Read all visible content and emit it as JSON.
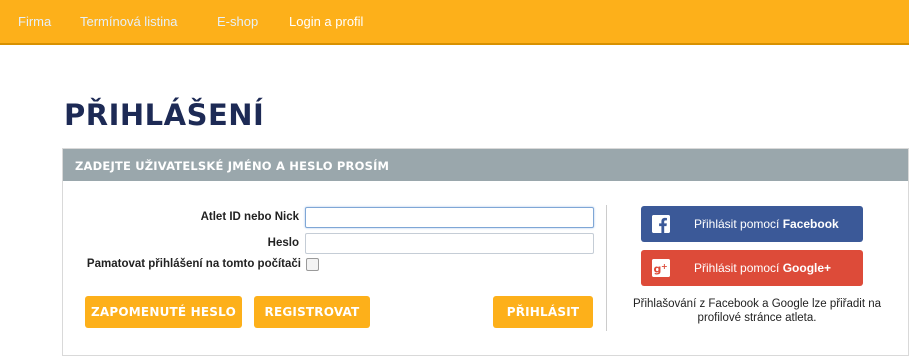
{
  "nav": {
    "items": [
      {
        "label": "Firma"
      },
      {
        "label": "Termínová listina"
      },
      {
        "label": "E-shop"
      },
      {
        "label": "Login a profil"
      }
    ]
  },
  "page": {
    "title": "PŘIHLÁŠENÍ"
  },
  "panel": {
    "header": "ZADEJTE UŽIVATELSKÉ JMÉNO A HESLO PROSÍM",
    "form": {
      "username_label": "Atlet ID nebo Nick",
      "username_value": "",
      "password_label": "Heslo",
      "password_value": "",
      "remember_label": "Pamatovat přihlášení na tomto počítači",
      "remember_checked": false
    },
    "buttons": {
      "forgot": "ZAPOMENUTÉ HESLO",
      "register": "REGISTROVAT",
      "login": "PŘIHLÁSIT"
    },
    "social": {
      "facebook_prefix": "Přihlásit pomocí ",
      "facebook_brand": "Facebook",
      "google_prefix": "Přihlásit pomocí ",
      "google_brand": "Google+",
      "note": "Přihlašování z Facebook a Google lze přiřadit na profilové stránce atleta."
    }
  },
  "colors": {
    "accent": "#fdb01a",
    "title": "#1d2a55",
    "panel_header": "#9aa7ac",
    "facebook": "#3b5998",
    "google": "#dd4b39"
  }
}
